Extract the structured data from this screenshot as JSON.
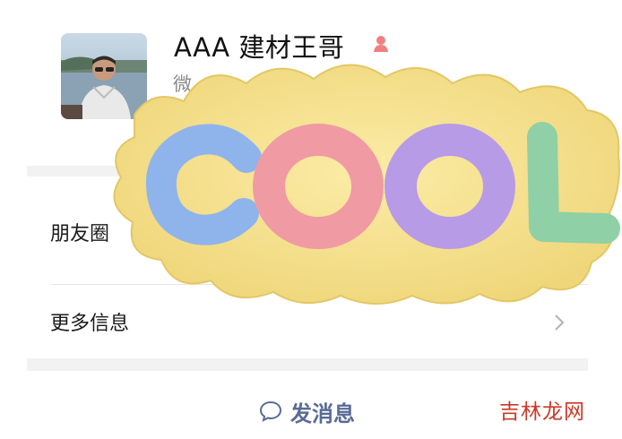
{
  "profile": {
    "name": "AAA 建材王哥",
    "wechat_id_prefix": "微",
    "gender": "female-icon"
  },
  "menu": {
    "moments_label": "朋友圈",
    "more_info_label": "更多信息"
  },
  "actions": {
    "send_message_label": "发消息"
  },
  "sticker": {
    "text": "COOL",
    "letter_colors": [
      "#8fb4ec",
      "#f09aa3",
      "#b79be6",
      "#8fd0a6"
    ],
    "blob_color": "#f5e28a"
  },
  "watermark": {
    "text": "吉林龙网"
  },
  "colors": {
    "link": "#576b95",
    "separator": "#f2f2f2",
    "watermark": "#c93a28"
  }
}
